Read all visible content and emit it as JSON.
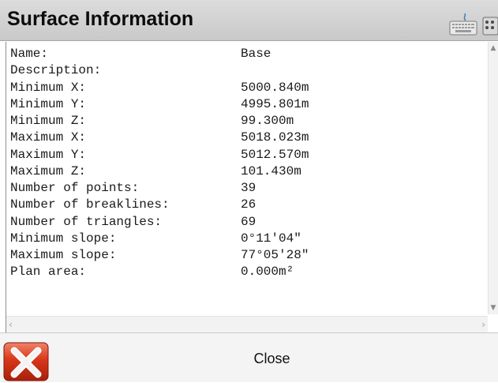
{
  "window": {
    "title": "Surface Information"
  },
  "toolbar": {
    "keyboard_icon": "keyboard-icon",
    "grid_icon": "grid-icon"
  },
  "info": [
    {
      "label": "Name:",
      "value": "Base"
    },
    {
      "label": "Description:",
      "value": ""
    },
    {
      "label": "Minimum X:",
      "value": "5000.840m"
    },
    {
      "label": "Minimum Y:",
      "value": "4995.801m"
    },
    {
      "label": "Minimum Z:",
      "value": "99.300m"
    },
    {
      "label": "Maximum X:",
      "value": "5018.023m"
    },
    {
      "label": "Maximum Y:",
      "value": "5012.570m"
    },
    {
      "label": "Maximum Z:",
      "value": "101.430m"
    },
    {
      "label": "Number of points:",
      "value": "39"
    },
    {
      "label": "Number of breaklines:",
      "value": "26"
    },
    {
      "label": "Number of triangles:",
      "value": "69"
    },
    {
      "label": "Minimum slope:",
      "value": "0°11'04\""
    },
    {
      "label": "Maximum slope:",
      "value": "77°05'28\""
    },
    {
      "label": "Plan area:",
      "value": "0.000m²"
    }
  ],
  "footer": {
    "close_label": "Close",
    "close_icon": "close-icon"
  },
  "colors": {
    "title_bar": "#d3d3d3",
    "close_icon_red": "#d8361a"
  }
}
